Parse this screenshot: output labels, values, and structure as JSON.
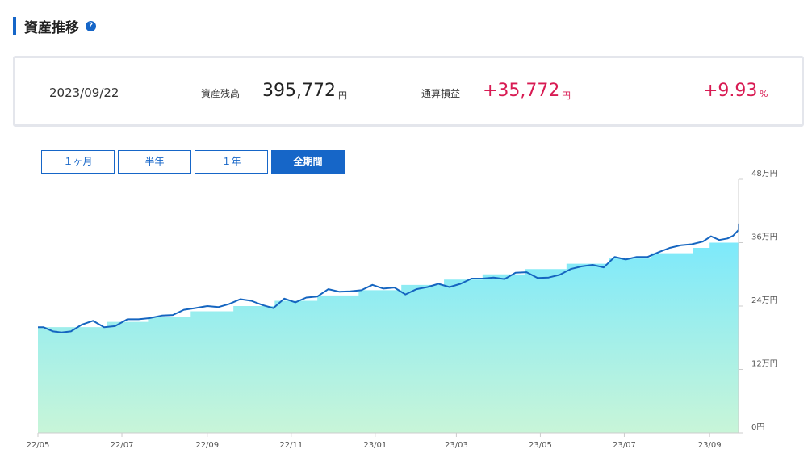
{
  "header": {
    "title": "資産推移",
    "help_icon": "?"
  },
  "summary": {
    "date": "2023/09/22",
    "balance_label": "資産残高",
    "balance_value": "395,772",
    "balance_unit": "円",
    "pl_label": "通算損益",
    "pl_value": "+35,772",
    "pl_unit": "円",
    "pl_pct": "+9.93",
    "pl_pct_unit": "%"
  },
  "tabs": [
    {
      "label": "１ヶ月",
      "active": false
    },
    {
      "label": "半年",
      "active": false
    },
    {
      "label": "１年",
      "active": false
    },
    {
      "label": "全期間",
      "active": true
    }
  ],
  "colors": {
    "accent": "#1666c8",
    "gain": "#d81b53",
    "line": "#1565c0",
    "area_top": "#7de9fb",
    "area_bottom": "#c8f5d8"
  },
  "chart_data": {
    "type": "area",
    "x_tick_labels": [
      "22/05",
      "22/07",
      "22/09",
      "22/11",
      "23/01",
      "23/03",
      "23/05",
      "23/07",
      "23/09"
    ],
    "y_tick_labels": [
      "0円",
      "12万円",
      "24万円",
      "36万円",
      "48万円"
    ],
    "ylim": [
      0,
      480000
    ],
    "y_axis_side": "right",
    "grid": false,
    "x_start": "2022-05-01",
    "x_end": "2023-09-22",
    "series": [
      {
        "role": "invested_amount",
        "values": [
          [
            "2022-05-01",
            200000
          ],
          [
            "2022-06-20",
            210000
          ],
          [
            "2022-07-20",
            220000
          ],
          [
            "2022-08-20",
            230000
          ],
          [
            "2022-09-20",
            240000
          ],
          [
            "2022-10-20",
            250000
          ],
          [
            "2022-11-20",
            260000
          ],
          [
            "2022-12-20",
            270000
          ],
          [
            "2023-01-20",
            280000
          ],
          [
            "2023-02-20",
            290000
          ],
          [
            "2023-03-20",
            300000
          ],
          [
            "2023-04-20",
            310000
          ],
          [
            "2023-05-20",
            320000
          ],
          [
            "2023-06-20",
            330000
          ],
          [
            "2023-07-20",
            340000
          ],
          [
            "2023-08-20",
            350000
          ],
          [
            "2023-09-01",
            360000
          ],
          [
            "2023-09-22",
            360000
          ]
        ]
      },
      {
        "role": "asset_value",
        "values": [
          [
            "2022-05-01",
            200000
          ],
          [
            "2022-05-05",
            200000
          ],
          [
            "2022-05-12",
            192000
          ],
          [
            "2022-05-18",
            190000
          ],
          [
            "2022-05-25",
            192000
          ],
          [
            "2022-06-02",
            205000
          ],
          [
            "2022-06-10",
            212000
          ],
          [
            "2022-06-18",
            200000
          ],
          [
            "2022-06-26",
            202000
          ],
          [
            "2022-07-05",
            215000
          ],
          [
            "2022-07-13",
            215000
          ],
          [
            "2022-07-21",
            217000
          ],
          [
            "2022-07-30",
            222000
          ],
          [
            "2022-08-07",
            223000
          ],
          [
            "2022-08-15",
            233000
          ],
          [
            "2022-08-23",
            236000
          ],
          [
            "2022-09-01",
            240000
          ],
          [
            "2022-09-09",
            238000
          ],
          [
            "2022-09-17",
            244000
          ],
          [
            "2022-09-25",
            253000
          ],
          [
            "2022-10-03",
            250000
          ],
          [
            "2022-10-11",
            242000
          ],
          [
            "2022-10-19",
            236000
          ],
          [
            "2022-10-27",
            254000
          ],
          [
            "2022-11-04",
            247000
          ],
          [
            "2022-11-12",
            256000
          ],
          [
            "2022-11-20",
            258000
          ],
          [
            "2022-11-28",
            272000
          ],
          [
            "2022-12-06",
            267000
          ],
          [
            "2022-12-14",
            268000
          ],
          [
            "2022-12-22",
            270000
          ],
          [
            "2022-12-30",
            280000
          ],
          [
            "2023-01-07",
            273000
          ],
          [
            "2023-01-15",
            275000
          ],
          [
            "2023-01-23",
            262000
          ],
          [
            "2023-01-31",
            272000
          ],
          [
            "2023-02-08",
            276000
          ],
          [
            "2023-02-16",
            282000
          ],
          [
            "2023-02-24",
            276000
          ],
          [
            "2023-03-04",
            282000
          ],
          [
            "2023-03-12",
            292000
          ],
          [
            "2023-03-20",
            292000
          ],
          [
            "2023-03-28",
            294000
          ],
          [
            "2023-04-05",
            291000
          ],
          [
            "2023-04-13",
            303000
          ],
          [
            "2023-04-21",
            304000
          ],
          [
            "2023-04-29",
            293000
          ],
          [
            "2023-05-07",
            294000
          ],
          [
            "2023-05-15",
            299000
          ],
          [
            "2023-05-23",
            310000
          ],
          [
            "2023-05-31",
            315000
          ],
          [
            "2023-06-08",
            318000
          ],
          [
            "2023-06-16",
            313000
          ],
          [
            "2023-06-24",
            333000
          ],
          [
            "2023-07-02",
            328000
          ],
          [
            "2023-07-10",
            333000
          ],
          [
            "2023-07-18",
            333000
          ],
          [
            "2023-07-26",
            342000
          ],
          [
            "2023-08-03",
            350000
          ],
          [
            "2023-08-11",
            355000
          ],
          [
            "2023-08-19",
            357000
          ],
          [
            "2023-08-27",
            362000
          ],
          [
            "2023-09-02",
            372000
          ],
          [
            "2023-09-08",
            365000
          ],
          [
            "2023-09-14",
            368000
          ],
          [
            "2023-09-18",
            373000
          ],
          [
            "2023-09-22",
            384000
          ],
          [
            "2023-09-22",
            384000
          ],
          [
            "2023-09-22",
            396000
          ]
        ]
      }
    ]
  }
}
